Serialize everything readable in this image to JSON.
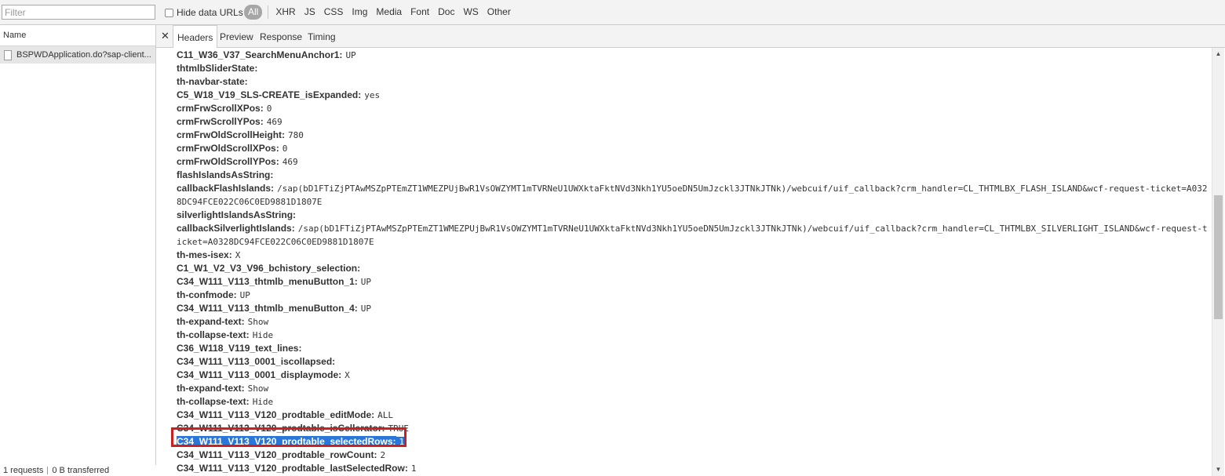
{
  "filter_bar": {
    "filter_placeholder": "Filter",
    "filter_value": "",
    "hide_data_urls_label": "Hide data URLs",
    "hide_data_urls_checked": false,
    "type_filters": [
      {
        "label": "All",
        "active": true
      },
      {
        "label": "XHR",
        "active": false
      },
      {
        "label": "JS",
        "active": false
      },
      {
        "label": "CSS",
        "active": false
      },
      {
        "label": "Img",
        "active": false
      },
      {
        "label": "Media",
        "active": false
      },
      {
        "label": "Font",
        "active": false
      },
      {
        "label": "Doc",
        "active": false
      },
      {
        "label": "WS",
        "active": false
      },
      {
        "label": "Other",
        "active": false
      }
    ]
  },
  "request_list": {
    "column_name": "Name",
    "requests": [
      {
        "name": "BSPWDApplication.do?sap-client...",
        "icon": "document-icon",
        "selected": true
      }
    ],
    "status": {
      "requests": "1 requests",
      "transferred": "0 B transferred"
    }
  },
  "details": {
    "close_icon": "close-icon",
    "tabs": [
      {
        "label": "Headers",
        "selected": true
      },
      {
        "label": "Preview",
        "selected": false
      },
      {
        "label": "Response",
        "selected": false
      },
      {
        "label": "Timing",
        "selected": false
      }
    ],
    "form_data": [
      {
        "key": "C11_W36_V37_SearchMenuAnchor1:",
        "value": "UP"
      },
      {
        "key": "thtmlbSliderState:",
        "value": ""
      },
      {
        "key": "th-navbar-state:",
        "value": ""
      },
      {
        "key": "C5_W18_V19_SLS-CREATE_isExpanded:",
        "value": "yes"
      },
      {
        "key": "crmFrwScrollXPos:",
        "value": "0"
      },
      {
        "key": "crmFrwScrollYPos:",
        "value": "469"
      },
      {
        "key": "crmFrwOldScrollHeight:",
        "value": "780"
      },
      {
        "key": "crmFrwOldScrollXPos:",
        "value": "0"
      },
      {
        "key": "crmFrwOldScrollYPos:",
        "value": "469"
      },
      {
        "key": "flashIslandsAsString:",
        "value": ""
      },
      {
        "key": "callbackFlashIslands:",
        "value": "/sap(bD1FTiZjPTAwMSZpPTEmZT1WMEZPUjBwR1VsOWZYMT1mTVRNeU1UWXktaFktNVd3Nkh1YU5oeDN5UmJzckl3JTNkJTNk)/webcuif/uif_callback?crm_handler=CL_THTMLBX_FLASH_ISLAND&wcf-request-ticket=A0328DC94FCE022C06C0ED9881D1807E",
        "wrap": true
      },
      {
        "key": "silverlightIslandsAsString:",
        "value": ""
      },
      {
        "key": "callbackSilverlightIslands:",
        "value": "/sap(bD1FTiZjPTAwMSZpPTEmZT1WMEZPUjBwR1VsOWZYMT1mTVRNeU1UWXktaFktNVd3Nkh1YU5oeDN5UmJzckl3JTNkJTNk)/webcuif/uif_callback?crm_handler=CL_THTMLBX_SILVERLIGHT_ISLAND&wcf-request-ticket=A0328DC94FCE022C06C0ED9881D1807E",
        "wrap": true
      },
      {
        "key": "th-mes-isex:",
        "value": "X"
      },
      {
        "key": "C1_W1_V2_V3_V96_bchistory_selection:",
        "value": ""
      },
      {
        "key": "C34_W111_V113_thtmlb_menuButton_1:",
        "value": "UP"
      },
      {
        "key": "th-confmode:",
        "value": "UP"
      },
      {
        "key": "C34_W111_V113_thtmlb_menuButton_4:",
        "value": "UP"
      },
      {
        "key": "th-expand-text:",
        "value": "Show"
      },
      {
        "key": "th-collapse-text:",
        "value": "Hide"
      },
      {
        "key": "C36_W118_V119_text_lines:",
        "value": ""
      },
      {
        "key": "C34_W111_V113_0001_iscollapsed:",
        "value": ""
      },
      {
        "key": "C34_W111_V113_0001_displaymode:",
        "value": "X"
      },
      {
        "key": "th-expand-text:",
        "value": "Show"
      },
      {
        "key": "th-collapse-text:",
        "value": "Hide"
      },
      {
        "key": "C34_W111_V113_V120_prodtable_editMode:",
        "value": "ALL"
      },
      {
        "key": "C34_W111_V113_V120_prodtable_isCellerator:",
        "value": "TRUE"
      },
      {
        "key": "C34_W111_V113_V120_prodtable_selectedRows:",
        "value": "1",
        "highlight": true
      },
      {
        "key": "C34_W111_V113_V120_prodtable_rowCount:",
        "value": "2"
      },
      {
        "key": "C34_W111_V113_V120_prodtable_lastSelectedRow:",
        "value": "1"
      }
    ]
  },
  "colors": {
    "selection": "#2a76d9",
    "annotation_box": "#cc1f1f",
    "toolbar_bg": "#f3f3f3"
  }
}
